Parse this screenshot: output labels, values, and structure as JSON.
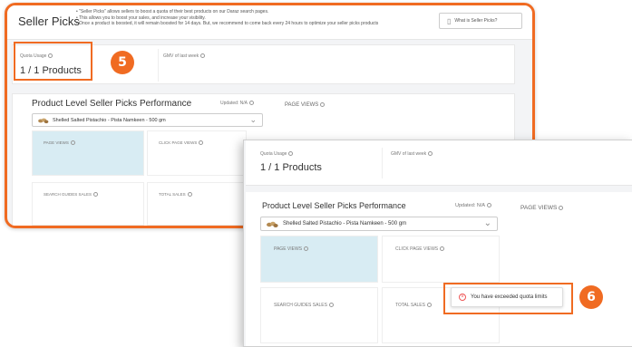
{
  "back": {
    "title": "Seller Picks",
    "description": [
      "\"Seller Picks\" allows sellers to boost a quota of their best products on our Daraz search pages.",
      "This allows you to boost your sales, and increase your visibility.",
      "Once a product is boosted, it will remain boosted for 14 days. But, we recommend to come back every 24 hours to optimize your seller picks products"
    ],
    "what_button": "What is Seller Picks?",
    "quota_label": "Quota Usage",
    "quota_value": "1 / 1 Products",
    "gmv_label": "GMV of last week",
    "perf_title": "Product Level Seller Picks Performance",
    "updated": "Updated: N/A",
    "page_views_side": "PAGE VIEWS",
    "select_value": "Shelled Salted Pistachio - Pista Namkeen - 500 gm",
    "tiles": {
      "page_views": "PAGE VIEWS",
      "click_page_views": "CLICK PAGE VIEWS",
      "search_guides_sales": "SEARCH GUIDES SALES",
      "total_sales": "TOTAL SALES"
    },
    "badge": "5"
  },
  "front": {
    "quota_label": "Quota Usage",
    "quota_value": "1 / 1 Products",
    "gmv_label": "GMV of last week",
    "perf_title": "Product Level Seller Picks Performance",
    "updated": "Updated: N/A",
    "page_views_side": "PAGE VIEWS",
    "select_value": "Shelled Salted Pistachio - Pista Namkeen - 500 gm",
    "tiles": {
      "page_views": "PAGE VIEWS",
      "click_page_views": "CLICK PAGE VIEWS",
      "search_guides_sales": "SEARCH GUIDES SALES",
      "total_sales": "TOTAL SALES"
    },
    "toast_message": "You have exceeded quota limits",
    "badge": "6"
  },
  "colors": {
    "accent": "#f06b22",
    "tile_highlight": "#d8ecf3",
    "error": "#e55555"
  }
}
